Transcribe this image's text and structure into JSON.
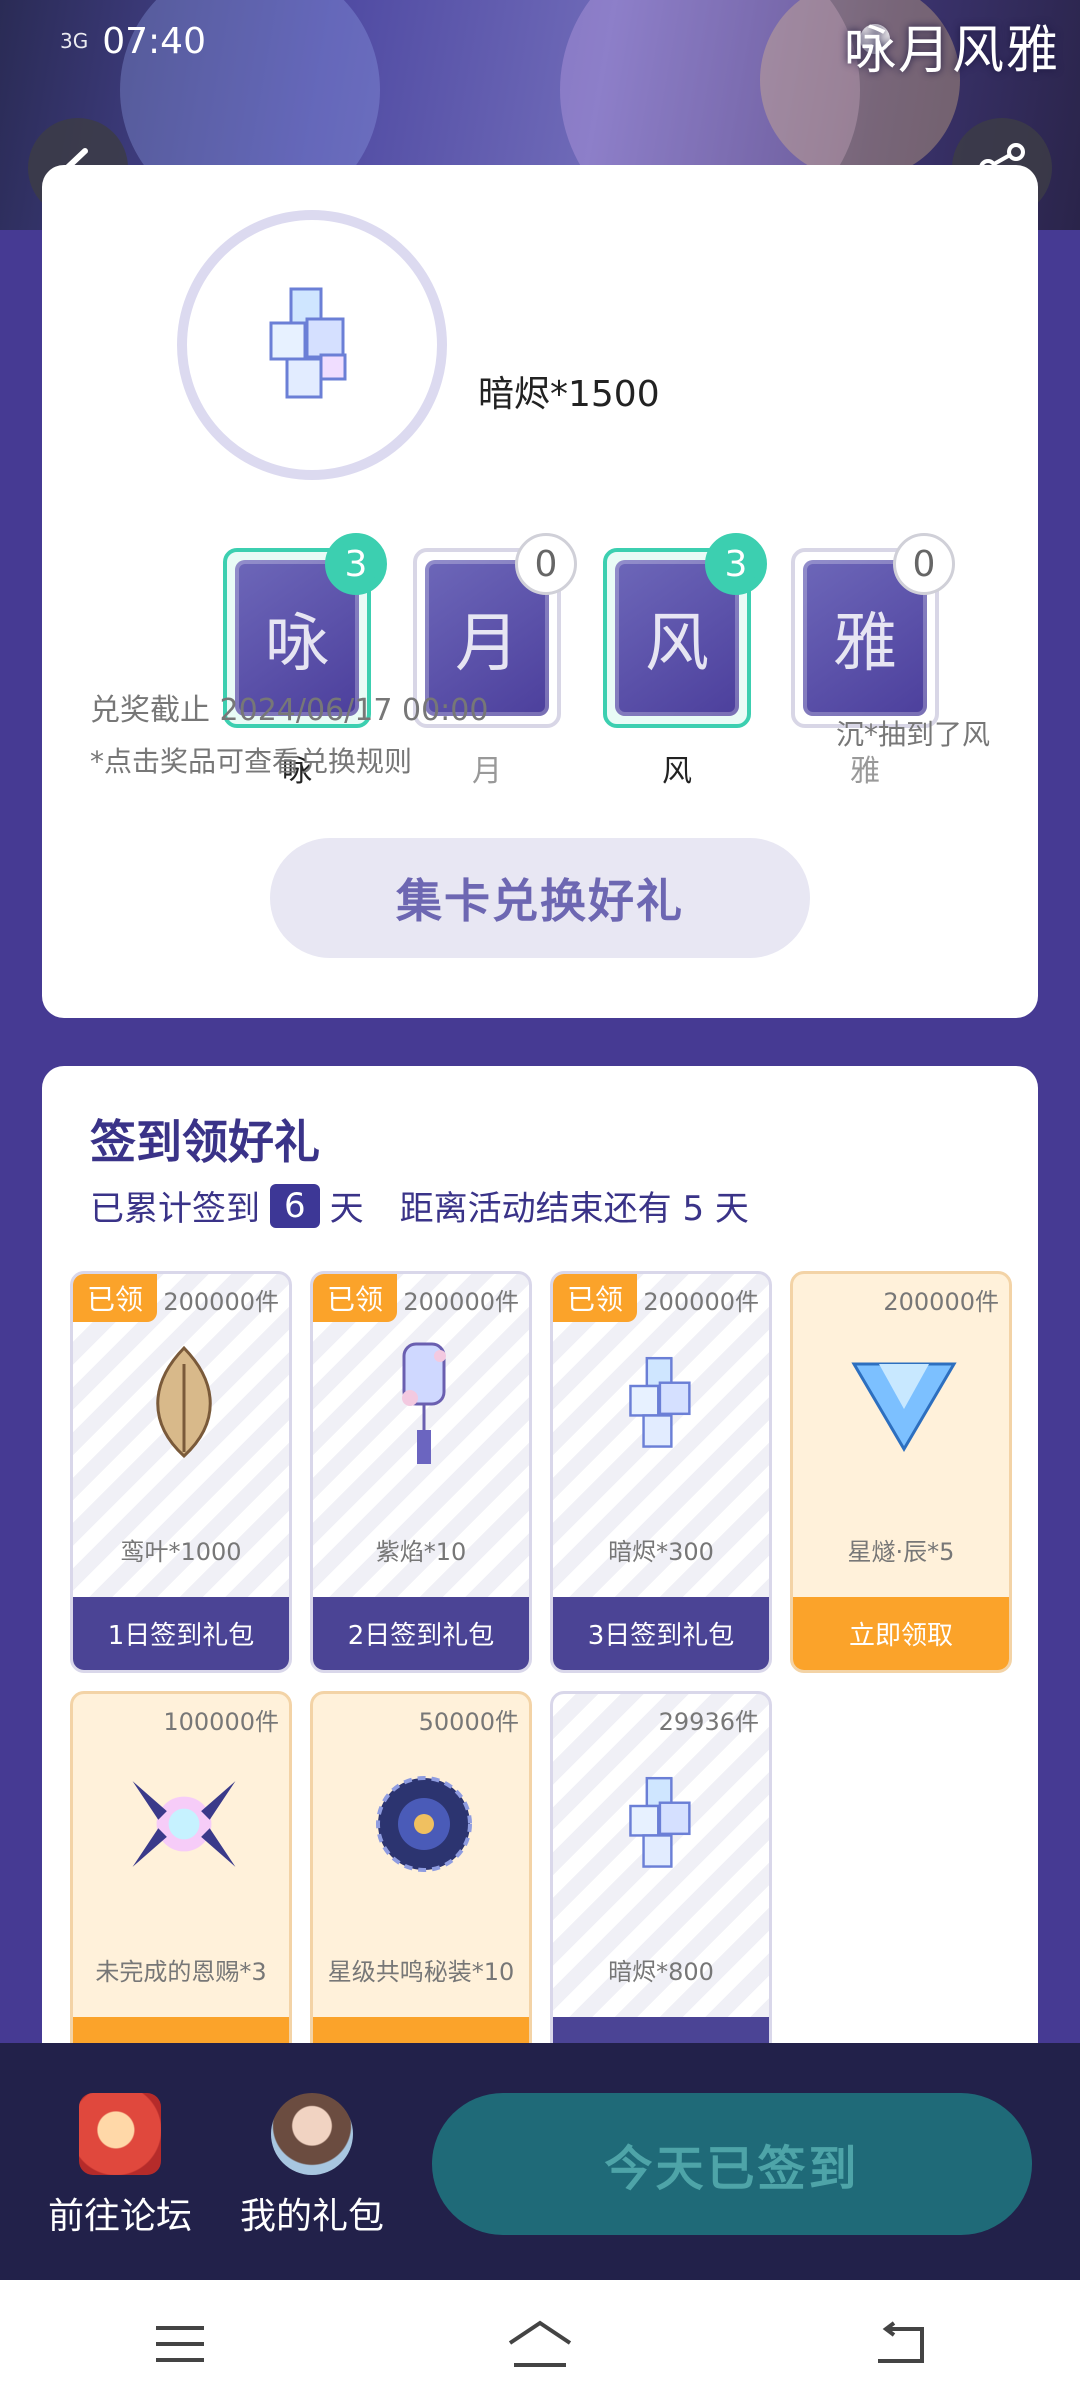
{
  "status_bar": {
    "network": "3G",
    "time": "07:40"
  },
  "banner": {
    "logo_text": "咏月风雅"
  },
  "header": {
    "back_icon": "chevron-left-icon",
    "share_icon": "share-icon"
  },
  "prize": {
    "name": "暗烬*1500"
  },
  "cards": [
    {
      "label": "咏",
      "glyph": "咏",
      "count": "3",
      "active": true
    },
    {
      "label": "月",
      "glyph": "月",
      "count": "0",
      "active": false
    },
    {
      "label": "风",
      "glyph": "风",
      "count": "3",
      "active": true
    },
    {
      "label": "雅",
      "glyph": "雅",
      "count": "0",
      "active": false
    }
  ],
  "info": {
    "deadline": "兑奖截止 2024/06/17 00:00",
    "hint": "*点击奖品可查看兑换规则",
    "draw_note": "沉*抽到了风"
  },
  "exchange_button": "集卡兑换好礼",
  "signin": {
    "title": "签到领好礼",
    "progress_prefix": "已累计签到",
    "days": "6",
    "progress_suffix": "天",
    "remaining": "距离活动结束还有 5 天"
  },
  "gifts": [
    {
      "stock": "200000件",
      "tag": "已领",
      "name": "鸾叶*1000",
      "action": "1日签到礼包",
      "style": "claimed"
    },
    {
      "stock": "200000件",
      "tag": "已领",
      "name": "紫焰*10",
      "action": "2日签到礼包",
      "style": "claimed"
    },
    {
      "stock": "200000件",
      "tag": "已领",
      "name": "暗烬*300",
      "action": "3日签到礼包",
      "style": "claimed"
    },
    {
      "stock": "200000件",
      "tag": "",
      "name": "星燧·辰*5",
      "action": "立即领取",
      "style": "available"
    },
    {
      "stock": "100000件",
      "tag": "",
      "name": "未完成的恩赐*3",
      "action": "",
      "style": "available"
    },
    {
      "stock": "50000件",
      "tag": "",
      "name": "星级共鸣秘装*10",
      "action": "",
      "style": "available"
    },
    {
      "stock": "29936件",
      "tag": "",
      "name": "暗烬*800",
      "action": "",
      "style": "claimed"
    }
  ],
  "bottom": {
    "forum_label": "前往论坛",
    "mygift_label": "我的礼包",
    "checkin_button": "今天已签到"
  },
  "colors": {
    "brand_purple": "#463a93",
    "accent_teal": "#3ccfb0",
    "accent_orange": "#fba32a",
    "dark_teal": "#1f6a78"
  }
}
